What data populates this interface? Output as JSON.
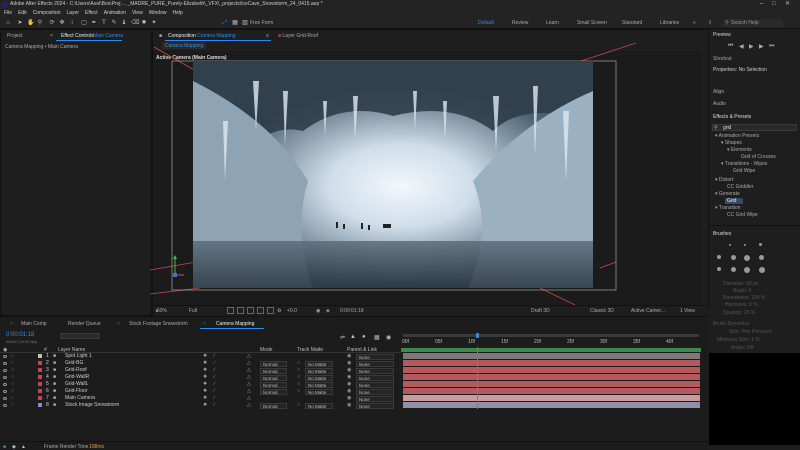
{
  "titlebar": {
    "title": "Adobe After Effects 2024 - C:\\Users\\Axel\\Box\\Proj ... _MADRE_PURE_Purely-Elizabeth\\_VFX\\_projects\\IceCave_Snowstorm_24_0415.aep *"
  },
  "menu": [
    "File",
    "Edit",
    "Composition",
    "Layer",
    "Effect",
    "Animation",
    "View",
    "Window",
    "Help"
  ],
  "toolbar": {
    "free_form": "Free Form",
    "workspaces": [
      "Default",
      "Review",
      "Learn",
      "Small Screen",
      "Standard",
      "Libraries"
    ],
    "active_workspace": "Default",
    "search_placeholder": "Search Help"
  },
  "left_panel": {
    "tabs": [
      "Project",
      "Effect Controls",
      "Main Camera"
    ],
    "breadcrumb": "Camera Mapping • Main Camera"
  },
  "comp_panel": {
    "tab_comp_prefix": "Composition",
    "tab_comp_name": "Camera Mapping",
    "tab_layer_prefix": "Layer",
    "tab_layer_name": "Grid-Roof",
    "subtab": "Camera Mapping",
    "view_label": "Active Camera (Main Camera)",
    "footer": {
      "zoom": "50%",
      "resolution": "Full",
      "exposure": "+0.0",
      "timecode": "0:00:01:18",
      "draft": "Draft 3D",
      "renderer": "Classic 3D",
      "camera": "Active Camer...",
      "views": "1 View"
    }
  },
  "right_panel": {
    "preview": "Preview",
    "shortcut": "Shortcut",
    "properties": "Properties: No Selection",
    "align": "Align",
    "audio": "Audio",
    "effects_presets": "Effects & Presets",
    "search_value": "grid",
    "tree": [
      "▾ Animation Presets",
      "▾ Shapes",
      "▾ Elements",
      "Grid of Crosses",
      "▾ Transitions - Wipes",
      "Grid Wipe",
      "▾ Distort",
      "CC Griddler",
      "▾ Generate",
      "Grid",
      "▾ Transition",
      "CC Grid Wipe"
    ],
    "brushes": "Brushes",
    "brush_params": [
      "Diameter:  50 px",
      "Angle:  0",
      "Roundness:  100 %",
      "Hardness:  0 %",
      "Spacing:  25 %",
      "Brush Dynamics",
      "Size:  Pen Pressure",
      "Minimum Size:  1 %",
      "Angle:  Off"
    ]
  },
  "timeline": {
    "tabs": [
      "Main Comp",
      "Render Queue",
      "Stock Footage Snowstorm",
      "Camera Mapping"
    ],
    "active_tab": "Camera Mapping",
    "timecode": "0:00:01:18",
    "timecode_sub": "00042 (24.00 fps)",
    "columns": {
      "num": "#",
      "layer_name": "Layer Name",
      "mode": "Mode",
      "track_matte": "Track Matte",
      "parent": "Parent & Link"
    },
    "ruler": [
      "00f",
      "05f",
      "10f",
      "15f",
      "20f",
      "25f",
      "30f",
      "35f",
      "40f"
    ],
    "layers": [
      {
        "num": "1",
        "name": "Spot Light 1",
        "mode": "",
        "matte": "",
        "parent": "None",
        "label": "#c9c69b",
        "bar": "#7a7a7a",
        "icon": "light"
      },
      {
        "num": "2",
        "name": "Grid-BG",
        "mode": "Normal",
        "matte": "No Matte",
        "parent": "None",
        "label": "#c0464f",
        "bar": "#b4595e",
        "icon": "solid"
      },
      {
        "num": "3",
        "name": "Grid-Roof",
        "mode": "Normal",
        "matte": "No Matte",
        "parent": "None",
        "label": "#c0464f",
        "bar": "#b4595e",
        "icon": "solid"
      },
      {
        "num": "4",
        "name": "Grid-WallR",
        "mode": "Normal",
        "matte": "No Matte",
        "parent": "None",
        "label": "#c0464f",
        "bar": "#b4595e",
        "icon": "solid"
      },
      {
        "num": "5",
        "name": "Grid-WallL",
        "mode": "Normal",
        "matte": "No Matte",
        "parent": "None",
        "label": "#c0464f",
        "bar": "#b4595e",
        "icon": "solid"
      },
      {
        "num": "6",
        "name": "Grid-Floor",
        "mode": "Normal",
        "matte": "No Matte",
        "parent": "None",
        "label": "#c0464f",
        "bar": "#b4595e",
        "icon": "solid"
      },
      {
        "num": "7",
        "name": "Main Camera",
        "mode": "",
        "matte": "",
        "parent": "None",
        "label": "#c0464f",
        "bar": "#c99a9e",
        "icon": "camera"
      },
      {
        "num": "8",
        "name": "Stock Image Snowstorm",
        "mode": "Normal",
        "matte": "No Matte",
        "parent": "None",
        "label": "#8a8ad0",
        "bar": "#8f8fa8",
        "icon": "footage"
      }
    ],
    "status_label": "Frame Render Time",
    "status_value": "108ms"
  },
  "colors": {
    "accent": "#2d8ceb",
    "playhead": "#2d8ceb",
    "bar_red": "#b4595e",
    "bar_green": "#3d8a4a"
  }
}
